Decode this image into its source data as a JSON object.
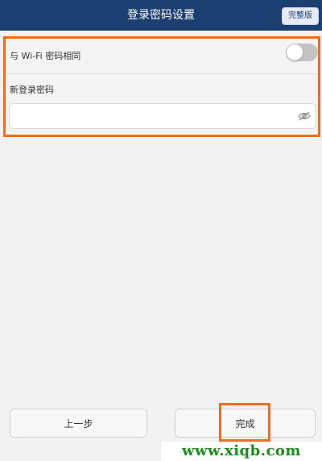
{
  "header": {
    "title": "登录密码设置",
    "full_version_label": "完整版"
  },
  "settings": {
    "same_as_wifi_label": "与 Wi-Fi 密码相同",
    "same_as_wifi_enabled": false,
    "new_password_label": "新登录密码",
    "new_password_value": ""
  },
  "buttons": {
    "prev_label": "上一步",
    "done_label": "完成"
  },
  "watermark": "www.xiqb.com",
  "colors": {
    "header_bg": "#1a3f70",
    "highlight": "#ec6e22",
    "watermark": "#1f8a1f"
  },
  "icons": {
    "password_visibility": "eye-hidden-icon"
  }
}
